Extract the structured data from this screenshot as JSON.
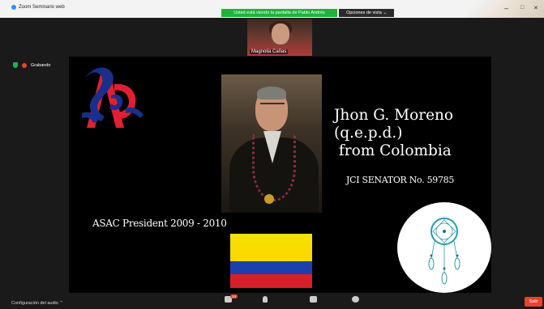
{
  "window": {
    "title": "Zoom Seminario web",
    "share_banner": "Usted está viendo la pantalla de Pablo Andrés",
    "view_options": "Opciones de vista",
    "minimize": "–",
    "maximize": "□",
    "close": "✕"
  },
  "participant": {
    "name": "Magnolia Cañas"
  },
  "status": {
    "recording": "Grabando"
  },
  "slide": {
    "name_block": "Jhon G. Moreno\n(q.e.p.d.)\n from Colombia",
    "senator": "JCI SENATOR No. 59785",
    "president": "ASAC President 2009 - 2010"
  },
  "toolbar": {
    "audio_settings": "Configuración del audio",
    "chat_badge": "14",
    "leave": "Salir"
  },
  "colors": {
    "share_banner": "#1fb33c",
    "leave": "#e8432d",
    "flag_yellow": "#ffd500",
    "flag_blue": "#1c3fae",
    "flag_red": "#d71f2a"
  }
}
